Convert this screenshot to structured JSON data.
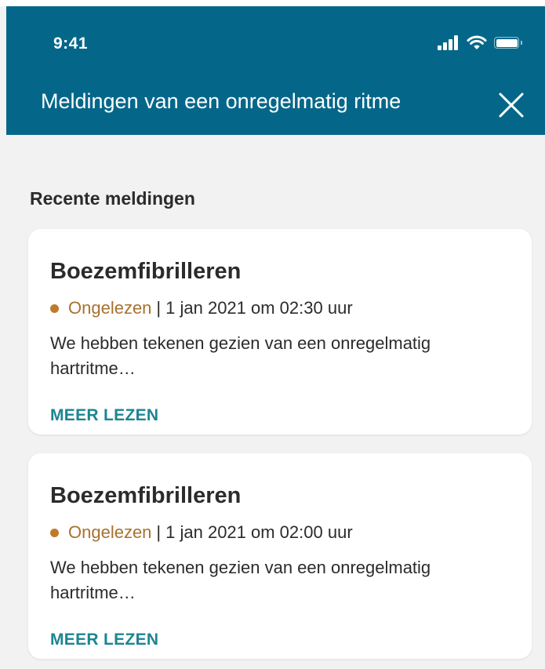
{
  "status_bar": {
    "time": "9:41",
    "icons": [
      "signal-icon",
      "wifi-icon",
      "battery-icon"
    ]
  },
  "header": {
    "title": "Meldingen van een onregelmatig ritme",
    "close_icon": "close-icon",
    "background_color": "#04678a"
  },
  "section": {
    "heading": "Recente meldingen"
  },
  "notifications": [
    {
      "title": "Boezemfibrilleren",
      "status": "Ongelezen",
      "separator": "|",
      "datetime": "1 jan 2021 om 02:30 uur",
      "body": "We hebben tekenen gezien van een onregelmatig hartritme…",
      "action": "MEER LEZEN"
    },
    {
      "title": "Boezemfibrilleren",
      "status": "Ongelezen",
      "separator": "|",
      "datetime": "1 jan 2021 om 02:00 uur",
      "body": "We hebben tekenen gezien van een onregelmatig hartritme…",
      "action": "MEER LEZEN"
    }
  ],
  "colors": {
    "unread": "#c07a2c",
    "action": "#1c8591",
    "background": "#f2f2f2"
  }
}
